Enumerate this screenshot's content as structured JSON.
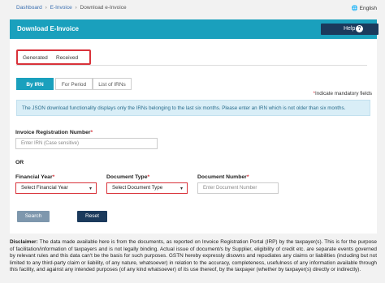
{
  "breadcrumb": {
    "items": [
      "Dashboard",
      "E-Invoice",
      "Download e-Invoice"
    ],
    "sep": "›"
  },
  "language": {
    "label": "English",
    "icon": "globe-icon"
  },
  "header": {
    "title": "Download E-Invoice",
    "help_label": "Help",
    "help_icon": "question-icon"
  },
  "tabs": [
    {
      "label": "Generated"
    },
    {
      "label": "Received"
    }
  ],
  "subtabs": [
    {
      "label": "By IRN"
    },
    {
      "label": "For Period"
    },
    {
      "label": "List of IRNs"
    }
  ],
  "mandatory_note": "Indicate mandatory fields",
  "info_text": "The JSON download functionality displays only the IRNs belonging to the last six months. Please enter an IRN which is not older than six months.",
  "form": {
    "irn_label": "Invoice Registration Number",
    "irn_placeholder": "Enter IRN (Case sensitive)",
    "or_label": "OR",
    "fy_label": "Financial Year",
    "fy_value": "Select Financial Year",
    "doc_type_label": "Document Type",
    "doc_type_value": "Select Document Type",
    "doc_number_label": "Document Number",
    "doc_number_placeholder": "Enter Document Number",
    "search_label": "Search",
    "reset_label": "Reset"
  },
  "disclaimer": {
    "label": "Disclaimer:",
    "text": "The data made available here is from the documents, as reported on Invoice Registration Portal (IRP) by the taxpayer(s). This is for the purpose of facilitation/information of taxpayers and is not legally binding. Actual issue of document/s by Supplier, eligibility of credit etc. are separate events governed by relevant rules and this data can't be the basis for such purposes. GSTN hereby expressly disowns and repudiates any claims or liabilities (including but not limited to any third-party claim or liability, of any nature, whatsoever) in relation to the accuracy, completeness, usefulness of any information available through this facility, and against any intended purposes (of any kind whatsoever) of its use thereof, by the taxpayer (whether by taxpayer(s) directly or indirectly)."
  },
  "colors": {
    "teal": "#1aa0bd",
    "navy": "#1b3a5c",
    "red_highlight": "#d9323a",
    "info_bg": "#d9eef7"
  }
}
